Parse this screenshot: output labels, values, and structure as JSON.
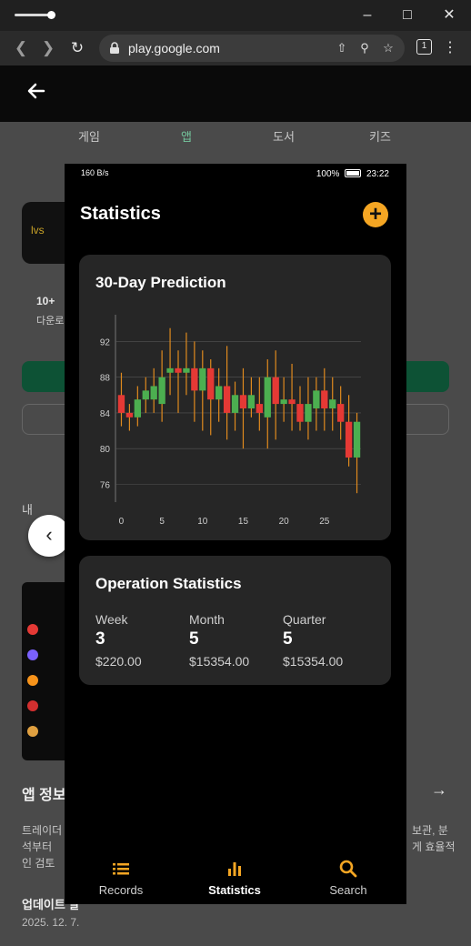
{
  "browser": {
    "url": "play.google.com",
    "tab_count": "1",
    "icons": [
      "back-icon",
      "forward-icon",
      "reload-icon",
      "lock-icon",
      "share-icon",
      "zoom-icon",
      "favorite-icon",
      "menu-icon"
    ]
  },
  "store": {
    "tabs": [
      "게임",
      "앱",
      "도서",
      "키즈"
    ],
    "active_tab": "앱",
    "app_icon_text": "lvs",
    "stat_value": "10+",
    "stat_label": "다운로",
    "section_title": "내",
    "info_title": "앱 정보",
    "desc_line1_left": "트레이더",
    "desc_line2_left": "석부터 ",
    "desc_line3_left": "인 검토",
    "desc_line1_right": "보관, 분",
    "desc_line2_right": "게 효율적",
    "update_label": "업데이트 날",
    "update_date": "2025. 12. 7."
  },
  "phone": {
    "status_left": "160 B/s",
    "battery": "100%",
    "time": "23:22",
    "title": "Statistics",
    "add_label": "+"
  },
  "prediction_card": {
    "title": "30-Day Prediction"
  },
  "chart_data": {
    "type": "candlestick",
    "title": "30-Day Prediction",
    "xlabel": "",
    "ylabel": "",
    "x_ticks": [
      "0",
      "5",
      "10",
      "15",
      "20",
      "25"
    ],
    "y_ticks": [
      "76",
      "80",
      "84",
      "88",
      "92"
    ],
    "xlim": [
      -0.5,
      29.5
    ],
    "ylim": [
      74,
      95
    ],
    "up_color": "#4caf50",
    "down_color": "#e53935",
    "wick_color": "#e08a1e",
    "candles": [
      {
        "x": 0,
        "open": 86,
        "close": 84,
        "high": 88.5,
        "low": 82.5
      },
      {
        "x": 1,
        "open": 84,
        "close": 83.5,
        "high": 85,
        "low": 82
      },
      {
        "x": 2,
        "open": 83.5,
        "close": 85.5,
        "high": 87,
        "low": 82.5
      },
      {
        "x": 3,
        "open": 85.5,
        "close": 86.5,
        "high": 88,
        "low": 84
      },
      {
        "x": 4,
        "open": 85.5,
        "close": 87,
        "high": 89,
        "low": 84
      },
      {
        "x": 5,
        "open": 85,
        "close": 88,
        "high": 91,
        "low": 83
      },
      {
        "x": 6,
        "open": 88.5,
        "close": 89,
        "high": 93.5,
        "low": 86
      },
      {
        "x": 7,
        "open": 89,
        "close": 88.5,
        "high": 91,
        "low": 84
      },
      {
        "x": 8,
        "open": 88.5,
        "close": 89,
        "high": 93,
        "low": 86
      },
      {
        "x": 9,
        "open": 89,
        "close": 86.5,
        "high": 92,
        "low": 83
      },
      {
        "x": 10,
        "open": 86.5,
        "close": 89,
        "high": 91,
        "low": 82
      },
      {
        "x": 11,
        "open": 89,
        "close": 85.5,
        "high": 90,
        "low": 81.5
      },
      {
        "x": 12,
        "open": 85.5,
        "close": 87,
        "high": 89,
        "low": 83
      },
      {
        "x": 13,
        "open": 87,
        "close": 84,
        "high": 91.5,
        "low": 81
      },
      {
        "x": 14,
        "open": 84,
        "close": 86,
        "high": 87.5,
        "low": 82
      },
      {
        "x": 15,
        "open": 86,
        "close": 84.5,
        "high": 89,
        "low": 80
      },
      {
        "x": 16,
        "open": 84.5,
        "close": 86,
        "high": 88,
        "low": 83.5
      },
      {
        "x": 17,
        "open": 85,
        "close": 84,
        "high": 88,
        "low": 82
      },
      {
        "x": 18,
        "open": 83.5,
        "close": 88,
        "high": 90,
        "low": 80
      },
      {
        "x": 19,
        "open": 88,
        "close": 85,
        "high": 91,
        "low": 81
      },
      {
        "x": 20,
        "open": 85,
        "close": 85.5,
        "high": 88,
        "low": 83
      },
      {
        "x": 21,
        "open": 85.5,
        "close": 85,
        "high": 89.5,
        "low": 82
      },
      {
        "x": 22,
        "open": 85,
        "close": 83,
        "high": 87,
        "low": 82
      },
      {
        "x": 23,
        "open": 83,
        "close": 85,
        "high": 88,
        "low": 81
      },
      {
        "x": 24,
        "open": 84.5,
        "close": 86.5,
        "high": 88,
        "low": 82
      },
      {
        "x": 25,
        "open": 86.5,
        "close": 84.5,
        "high": 89,
        "low": 82
      },
      {
        "x": 26,
        "open": 84.5,
        "close": 85.5,
        "high": 88,
        "low": 82
      },
      {
        "x": 27,
        "open": 85,
        "close": 83,
        "high": 87,
        "low": 81
      },
      {
        "x": 28,
        "open": 83,
        "close": 79,
        "high": 86,
        "low": 78
      },
      {
        "x": 29,
        "open": 79,
        "close": 83,
        "high": 84,
        "low": 75
      }
    ],
    "grid": true,
    "legend": "none"
  },
  "operation_card": {
    "title": "Operation Statistics",
    "columns": [
      {
        "label": "Week",
        "count": "3",
        "amount": "$220.00"
      },
      {
        "label": "Month",
        "count": "5",
        "amount": "$15354.00"
      },
      {
        "label": "Quarter",
        "count": "5",
        "amount": "$15354.00"
      }
    ]
  },
  "bottom_nav": {
    "items": [
      {
        "label": "Records",
        "icon": "list-icon"
      },
      {
        "label": "Statistics",
        "icon": "bar-chart-icon"
      },
      {
        "label": "Search",
        "icon": "search-icon"
      }
    ],
    "active": "Statistics",
    "accent_color": "#f5a623"
  }
}
